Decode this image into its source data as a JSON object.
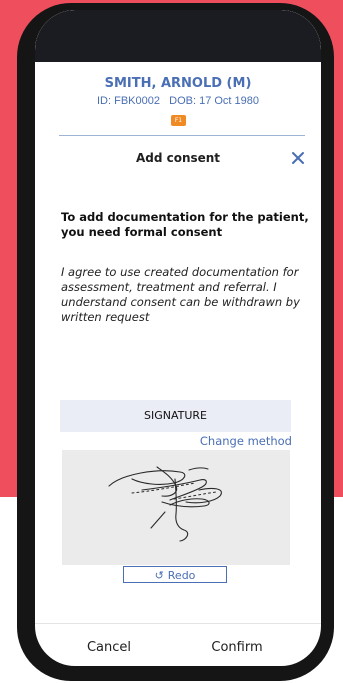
{
  "patient": {
    "name": "SMITH, ARNOLD (M)",
    "ids": "ID: FBK0002   DOB: 17 Oct 1980",
    "badge": "F1"
  },
  "modal": {
    "title": "Add consent",
    "close_icon": "close-icon",
    "instruction": "To add documentation for the patient, you need formal consent",
    "agreement": "I agree to use created documentation for assessment, treatment and referral. I understand consent can be withdrawn by written request"
  },
  "signature": {
    "label": "SIGNATURE",
    "change_method": "Change method",
    "redo_label": "Redo",
    "redo_icon": "undo-icon"
  },
  "footer": {
    "cancel": "Cancel",
    "confirm": "Confirm"
  },
  "colors": {
    "background_accent": "#ef4f5d",
    "brand_blue": "#4a6fb4",
    "badge_orange": "#f08a24"
  }
}
